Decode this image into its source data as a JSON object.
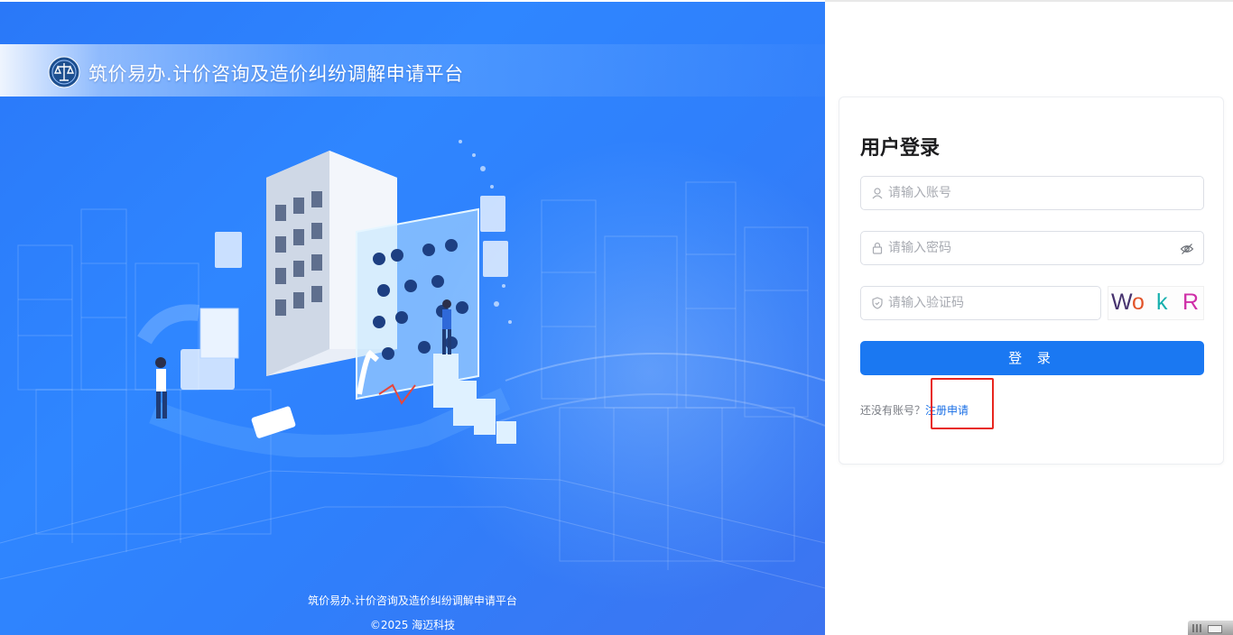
{
  "brand": {
    "platform_title": "筑价易办.计价咨询及造价纠纷调解申请平台",
    "logo_icon": "emblem-scales-icon"
  },
  "footer": {
    "platform_name": "筑价易办.计价咨询及造价纠纷调解申请平台",
    "copyright": "©2025 海迈科技"
  },
  "login": {
    "title": "用户登录",
    "username_placeholder": "请输入账号",
    "password_placeholder": "请输入密码",
    "captcha_placeholder": "请输入验证码",
    "captcha_chars": [
      "W",
      "o",
      "k",
      "R"
    ],
    "captcha_colors": [
      "#46326e",
      "#e2542a",
      "#17b0ae",
      "#cf2fa8"
    ],
    "submit_label": "登 录",
    "register_prompt": "还没有账号？",
    "register_link": "注册申请"
  },
  "colors": {
    "primary": "#1a78f2",
    "panel_blue": "#2f86ff",
    "highlight": "#e8261f"
  }
}
